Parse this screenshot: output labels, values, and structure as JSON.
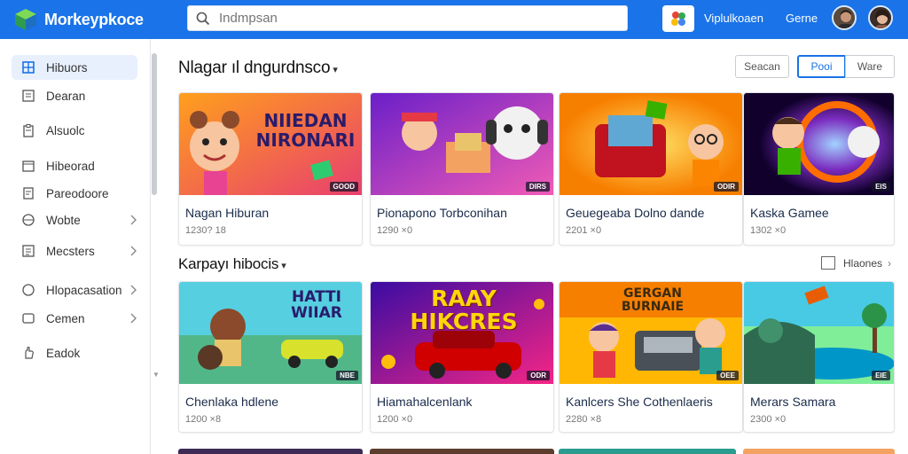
{
  "header": {
    "app_name": "Morkeypkoce",
    "search_placeholder": "Indmpsan",
    "link_1": "Viplulkoaen",
    "link_2": "Gerne"
  },
  "sidebar": {
    "items": [
      {
        "label": "Hibuors",
        "icon": "grid-icon"
      },
      {
        "label": "Dearan",
        "icon": "document-icon"
      },
      {
        "label": "Alsuolc",
        "icon": "clipboard-icon"
      },
      {
        "label": "Hibeorad",
        "icon": "calendar-icon"
      },
      {
        "label": "Pareodoore",
        "icon": "file-icon"
      },
      {
        "label": "Wobte",
        "icon": "globe-icon"
      },
      {
        "label": "Mecsters",
        "icon": "list-icon"
      },
      {
        "label": "Hlopacasation",
        "icon": "circle-icon"
      },
      {
        "label": "Cemen",
        "icon": "tag-icon"
      },
      {
        "label": "Eadok",
        "icon": "hand-icon"
      }
    ]
  },
  "main": {
    "section1_title": "Nlagar ıl dngurdnsco",
    "section2_title": "Karpayı hibocis",
    "filters": [
      "Seacan",
      "Pooi",
      "Ware"
    ],
    "section2_link": "Hlaones",
    "row1": [
      {
        "title": "Nagan Hiburan",
        "meta": "1230? 18",
        "badge": "GOOD"
      },
      {
        "title": "Pionapono Torbconihan",
        "meta": "1290 ×0",
        "badge": "DIRS"
      },
      {
        "title": "Geuegeaba Dolno dande",
        "meta": "2201 ×0",
        "badge": "ODIR"
      },
      {
        "title": "Kaska Gamee",
        "meta": "1302 ×0",
        "badge": "EIS"
      }
    ],
    "row2": [
      {
        "title": "Chenlaka hdlene",
        "meta": "1200 ×8",
        "badge": "NBE"
      },
      {
        "title": "Hiamahalcenlank",
        "meta": "1200 ×0",
        "badge": "ODR"
      },
      {
        "title": "Kanlcers She Cothenlaeris",
        "meta": "2280 ×8",
        "badge": "OEE"
      },
      {
        "title": "Merars Samara",
        "meta": "2300 ×0",
        "badge": "EIE"
      }
    ],
    "thumb_texts": {
      "card1": "NIIEDAN NIRONARI",
      "card5": "HATTI WIIAR",
      "card6": "RAAY HIKCRES",
      "card7": "GERGAN BURNAIE"
    }
  },
  "colors": {
    "brand_blue": "#1a73e8",
    "sidebar_active": "#e8f0fe"
  }
}
